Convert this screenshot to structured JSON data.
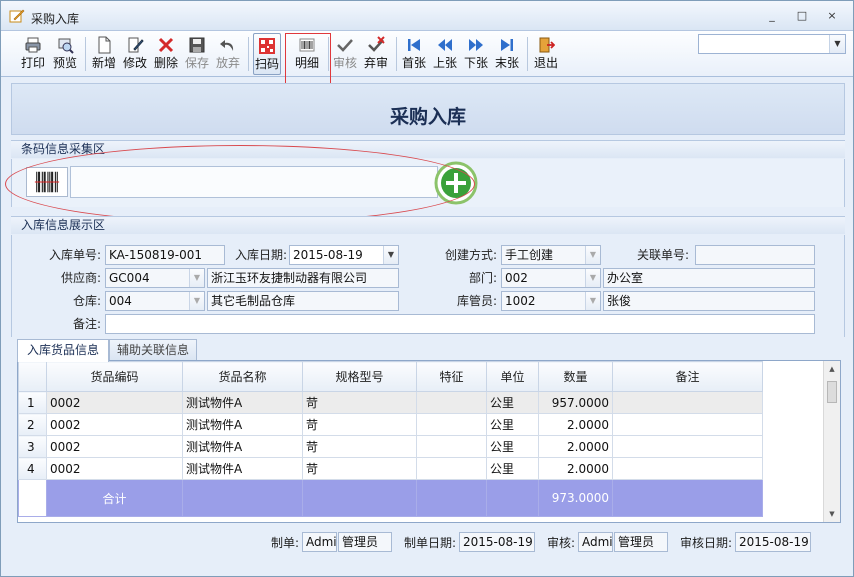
{
  "window": {
    "title": "采购入库",
    "controls": [
      "_",
      "□",
      "×"
    ]
  },
  "toolbar": {
    "buttons": [
      {
        "label": "打印",
        "icon": "printer-icon",
        "enabled": true
      },
      {
        "label": "预览",
        "icon": "preview-icon",
        "enabled": true
      },
      {
        "label": "新增",
        "icon": "new-document-icon",
        "enabled": true
      },
      {
        "label": "修改",
        "icon": "edit-icon",
        "enabled": true
      },
      {
        "label": "删除",
        "icon": "delete-icon",
        "enabled": true
      },
      {
        "label": "保存",
        "icon": "save-icon",
        "enabled": false
      },
      {
        "label": "放弃",
        "icon": "undo-icon",
        "enabled": false
      },
      {
        "label": "扫码",
        "icon": "qr-scan-icon",
        "enabled": true
      },
      {
        "label": "明细",
        "icon": "barcode-detail-icon",
        "enabled": true
      },
      {
        "label": "审核",
        "icon": "check-icon",
        "enabled": false
      },
      {
        "label": "弃审",
        "icon": "unapprove-icon",
        "enabled": true
      },
      {
        "label": "首张",
        "icon": "first-icon",
        "enabled": true
      },
      {
        "label": "上张",
        "icon": "prev-icon",
        "enabled": true
      },
      {
        "label": "下张",
        "icon": "next-icon",
        "enabled": true
      },
      {
        "label": "末张",
        "icon": "last-icon",
        "enabled": true
      },
      {
        "label": "退出",
        "icon": "exit-door-icon",
        "enabled": true
      }
    ],
    "combo_value": ""
  },
  "form": {
    "title": "采购入库"
  },
  "barcode_section": {
    "header": "条码信息采集区",
    "input_value": ""
  },
  "info_section": {
    "header": "入库信息展示区",
    "order_no_label": "入库单号:",
    "order_no": "KA-150819-001",
    "date_label": "入库日期:",
    "date": "2015-08-19",
    "create_mode_label": "创建方式:",
    "create_mode": "手工创建",
    "related_no_label": "关联单号:",
    "related_no": "",
    "supplier_label": "供应商:",
    "supplier_code": "GC004",
    "supplier_name": "浙江玉环友捷制动器有限公司",
    "dept_label": "部门:",
    "dept_code": "002",
    "dept_name": "办公室",
    "warehouse_label": "仓库:",
    "warehouse_code": "004",
    "warehouse_name": "其它毛制品仓库",
    "keeper_label": "库管员:",
    "keeper_code": "1002",
    "keeper_name": "张俊",
    "remark_label": "备注:",
    "remark": ""
  },
  "tabs": [
    "入库货品信息",
    "辅助关联信息"
  ],
  "grid": {
    "columns": [
      "货品编码",
      "货品名称",
      "规格型号",
      "特征",
      "单位",
      "数量",
      "备注"
    ],
    "rows": [
      {
        "n": "1",
        "code": "0002",
        "name": "测试物件A",
        "spec": "苛",
        "feature": "",
        "unit": "公里",
        "qty": "957.0000",
        "remark": ""
      },
      {
        "n": "2",
        "code": "0002",
        "name": "测试物件A",
        "spec": "苛",
        "feature": "",
        "unit": "公里",
        "qty": "2.0000",
        "remark": ""
      },
      {
        "n": "3",
        "code": "0002",
        "name": "测试物件A",
        "spec": "苛",
        "feature": "",
        "unit": "公里",
        "qty": "2.0000",
        "remark": ""
      },
      {
        "n": "4",
        "code": "0002",
        "name": "测试物件A",
        "spec": "苛",
        "feature": "",
        "unit": "公里",
        "qty": "2.0000",
        "remark": ""
      }
    ],
    "total_label": "合计",
    "total_qty": "973.0000"
  },
  "footer": {
    "maker_label": "制单:",
    "maker_code": "Admi",
    "maker_name": "管理员",
    "make_date_label": "制单日期:",
    "make_date": "2015-08-19",
    "auditor_label": "审核:",
    "auditor_code": "Admi",
    "auditor_name": "管理员",
    "audit_date_label": "审核日期:",
    "audit_date": "2015-08-19"
  },
  "colors": {
    "accent": "#1b2f55",
    "total_row": "#9a9ee8",
    "highlight": "#e0383c",
    "add_button": "#3aa13a"
  }
}
